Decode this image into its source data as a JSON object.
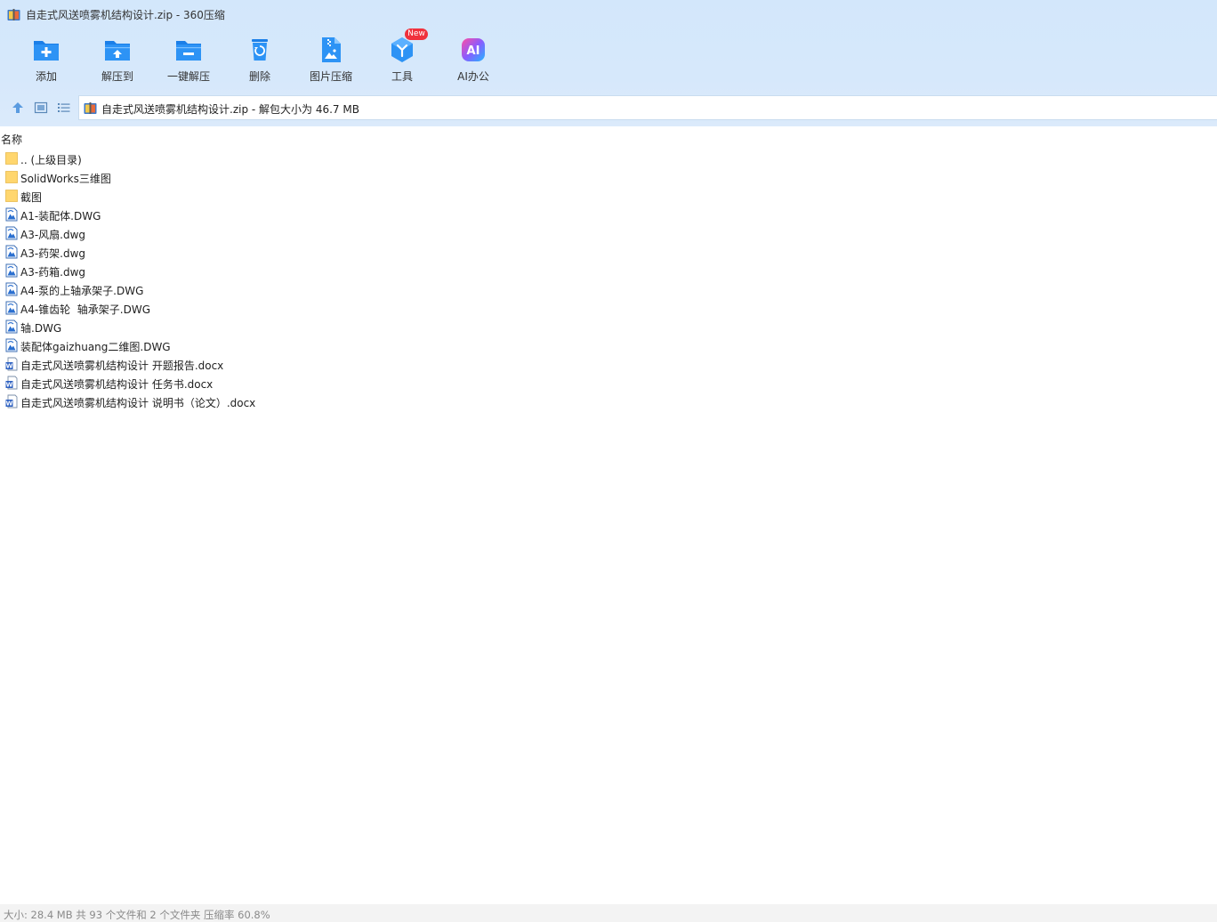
{
  "window": {
    "title": "自走式风送喷雾机结构设计.zip - 360压缩"
  },
  "toolbar": {
    "items": [
      {
        "label": "添加",
        "icon": "add-folder-icon"
      },
      {
        "label": "解压到",
        "icon": "extract-to-icon"
      },
      {
        "label": "一键解压",
        "icon": "one-click-extract-icon"
      },
      {
        "label": "删除",
        "icon": "recycle-bin-icon"
      },
      {
        "label": "图片压缩",
        "icon": "image-compress-icon"
      },
      {
        "label": "工具",
        "icon": "tools-icon",
        "badge": "New"
      },
      {
        "label": "AI办公",
        "icon": "ai-office-icon"
      }
    ]
  },
  "address": {
    "text": "自走式风送喷雾机结构设计.zip - 解包大小为 46.7 MB"
  },
  "columns": {
    "name": "名称"
  },
  "files": [
    {
      "name": ".. (上级目录)",
      "type": "folder"
    },
    {
      "name": "SolidWorks三维图",
      "type": "folder"
    },
    {
      "name": "截图",
      "type": "folder"
    },
    {
      "name": "A1-装配体.DWG",
      "type": "dwg"
    },
    {
      "name": "A3-风扇.dwg",
      "type": "dwg"
    },
    {
      "name": "A3-药架.dwg",
      "type": "dwg"
    },
    {
      "name": "A3-药箱.dwg",
      "type": "dwg"
    },
    {
      "name": "A4-泵的上轴承架子.DWG",
      "type": "dwg"
    },
    {
      "name": "A4-锥齿轮  轴承架子.DWG",
      "type": "dwg"
    },
    {
      "name": "轴.DWG",
      "type": "dwg"
    },
    {
      "name": "装配体gaizhuang二维图.DWG",
      "type": "dwg"
    },
    {
      "name": "自走式风送喷雾机结构设计 开题报告.docx",
      "type": "docx"
    },
    {
      "name": "自走式风送喷雾机结构设计 任务书.docx",
      "type": "docx"
    },
    {
      "name": "自走式风送喷雾机结构设计 说明书（论文）.docx",
      "type": "docx"
    }
  ],
  "status": {
    "text": "大小: 28.4 MB 共 93 个文件和 2 个文件夹 压缩率 60.8%"
  },
  "colors": {
    "accent": "#2b8bf2",
    "header_bg": "#d6e8fb",
    "folder": "#ffd66e",
    "badge": "#f0313d"
  }
}
